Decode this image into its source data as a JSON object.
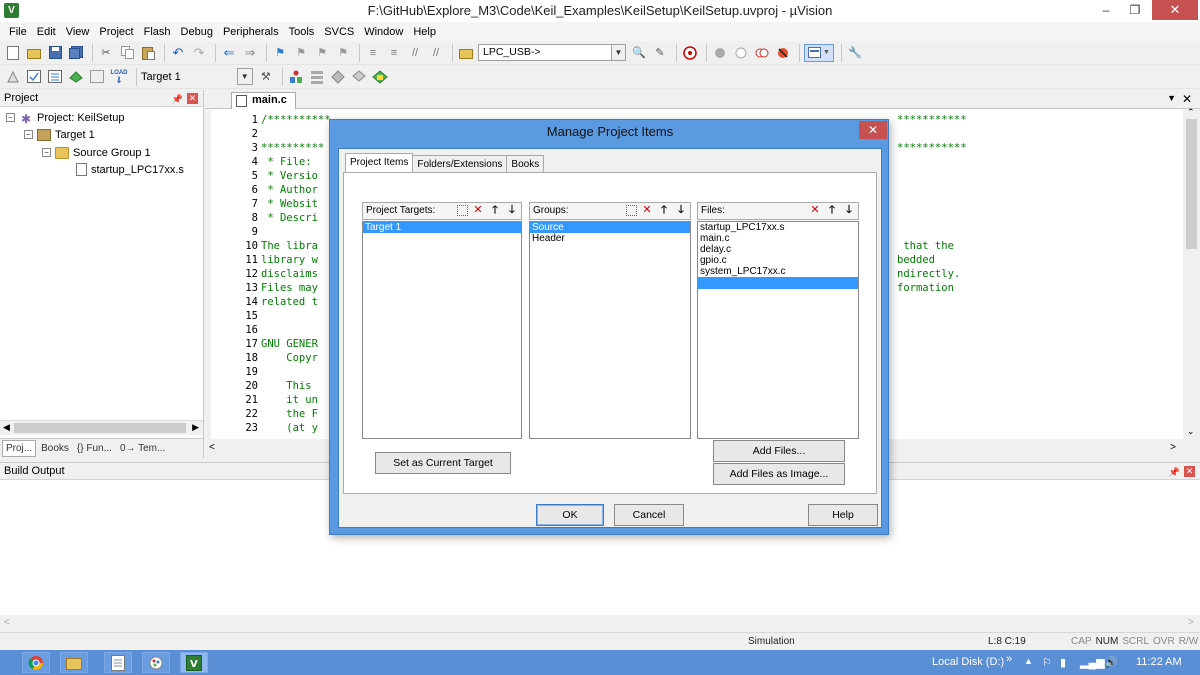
{
  "window": {
    "title": "F:\\GitHub\\Explore_M3\\Code\\Keil_Examples\\KeilSetup\\KeilSetup.uvproj - µVision",
    "app_icon": "V",
    "min": "–",
    "max": "❐",
    "close": "✕"
  },
  "menu": [
    "File",
    "Edit",
    "View",
    "Project",
    "Flash",
    "Debug",
    "Peripherals",
    "Tools",
    "SVCS",
    "Window",
    "Help"
  ],
  "toolbar1": {
    "target_combo": "LPC_USB->"
  },
  "toolbar2": {
    "target_select": "Target 1",
    "load_label": "LOAD"
  },
  "project_panel": {
    "title": "Project",
    "tree": {
      "project": "Project: KeilSetup",
      "target": "Target 1",
      "group": "Source Group 1",
      "file": "startup_LPC17xx.s"
    },
    "tabs": [
      "Proj...",
      "Books",
      "{} Fun...",
      "0→ Tem..."
    ]
  },
  "editor": {
    "tab": "main.c",
    "lines": [
      {
        "n": "1",
        "t": "/**********"
      },
      {
        "n": "2",
        "t": ""
      },
      {
        "n": "3",
        "t": "**********"
      },
      {
        "n": "4",
        "t": " * File:"
      },
      {
        "n": "5",
        "t": " * Versio"
      },
      {
        "n": "6",
        "t": " * Author"
      },
      {
        "n": "7",
        "t": " * Websit"
      },
      {
        "n": "8",
        "t": " * Descri"
      },
      {
        "n": "9",
        "t": ""
      },
      {
        "n": "10",
        "t": "The libra"
      },
      {
        "n": "11",
        "t": "library w"
      },
      {
        "n": "12",
        "t": "disclaims"
      },
      {
        "n": "13",
        "t": "Files may"
      },
      {
        "n": "14",
        "t": "related t"
      },
      {
        "n": "15",
        "t": ""
      },
      {
        "n": "16",
        "t": ""
      },
      {
        "n": "17",
        "t": "GNU GENER"
      },
      {
        "n": "18",
        "t": "    Copyr"
      },
      {
        "n": "19",
        "t": ""
      },
      {
        "n": "20",
        "t": "    This "
      },
      {
        "n": "21",
        "t": "    it un"
      },
      {
        "n": "22",
        "t": "    the F"
      },
      {
        "n": "23",
        "t": "    (at y"
      }
    ],
    "right_fragments": [
      {
        "row": 0,
        "t": "***********"
      },
      {
        "row": 2,
        "t": "***********"
      },
      {
        "row": 9,
        "t": " that the"
      },
      {
        "row": 10,
        "t": "bedded"
      },
      {
        "row": 11,
        "t": "ndirectly."
      },
      {
        "row": 12,
        "t": "formation"
      }
    ]
  },
  "build_output": {
    "title": "Build Output"
  },
  "status": {
    "mode": "Simulation",
    "position": "L:8 C:19",
    "indicators": [
      "CAP",
      "NUM",
      "SCRL",
      "OVR",
      "R/W"
    ]
  },
  "taskbar": {
    "local_disk": "Local Disk (D:)",
    "chevron": "»",
    "time": "11:22 AM"
  },
  "dialog": {
    "title": "Manage Project Items",
    "tabs": [
      "Project Items",
      "Folders/Extensions",
      "Books"
    ],
    "targets_label": "Project Targets:",
    "targets": [
      "Target 1"
    ],
    "groups_label": "Groups:",
    "groups": [
      "Source",
      "Header"
    ],
    "files_label": "Files:",
    "files": [
      "startup_LPC17xx.s",
      "main.c",
      "delay.c",
      "gpio.c",
      "system_LPC17xx.c"
    ],
    "set_current": "Set as Current Target",
    "add_files": "Add Files...",
    "add_files_image": "Add Files as Image...",
    "ok": "OK",
    "cancel": "Cancel",
    "help": "Help"
  }
}
